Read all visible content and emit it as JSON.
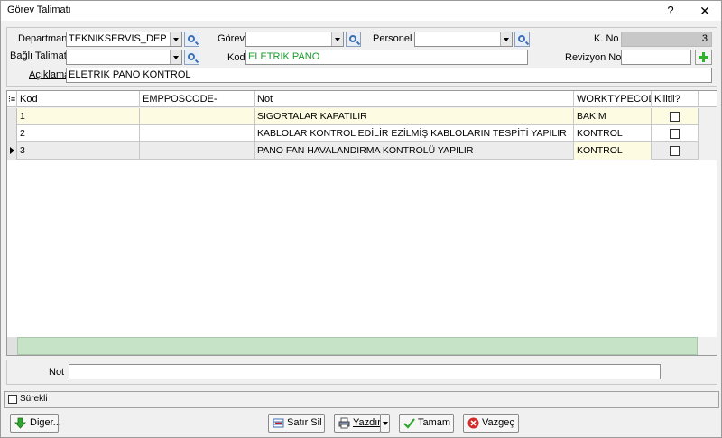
{
  "window": {
    "title": "Görev Talimatı",
    "help": "?",
    "close": "✕"
  },
  "form": {
    "departman_label": "Departman",
    "departman_value": "TEKNIKSERVIS_DEP",
    "gorev_label": "Görev",
    "gorev_value": "",
    "personel_label": "Personel",
    "personel_value": "",
    "kno_label": "K. No",
    "kno_value": "3",
    "bagli_label": "Bağlı Talimat",
    "bagli_value": "",
    "kod_label": "Kod",
    "kod_value": "ELETRIK PANO",
    "revizyon_label": "Revizyon No",
    "revizyon_value": "",
    "aciklama_label": "Açıklama",
    "aciklama_value": "ELETRIK PANO KONTROL"
  },
  "grid": {
    "columns": [
      "Kod",
      "EMPPOSCODE-",
      "Not",
      "WORKTYPECOD",
      "Kilitli?"
    ],
    "rows": [
      {
        "kod": "1",
        "emp": "",
        "not": "SIGORTALAR KAPATILIR",
        "worktype": "BAKIM",
        "kilitli": false
      },
      {
        "kod": "2",
        "emp": "",
        "not": "KABLOLAR KONTROL EDİLİR EZİLMİŞ KABLOLARIN TESPİTİ YAPILIR",
        "worktype": "KONTROL",
        "kilitli": false
      },
      {
        "kod": "3",
        "emp": "",
        "not": "PANO FAN HAVALANDIRMA KONTROLÜ YAPILIR",
        "worktype": "KONTROL",
        "kilitli": false
      }
    ],
    "current_row": 3
  },
  "not_field": {
    "label": "Not",
    "value": ""
  },
  "footer": {
    "surekli_label": "Sürekli",
    "diger_label": "Diger...",
    "satir_sil_label": "Satır Sil",
    "yazdir_label": "Yazdır",
    "tamam_label": "Tamam",
    "vazgec_label": "Vazgeç"
  },
  "colors": {
    "highlight_row": "#fdfbe2",
    "grid_footer": "#c7e3c7",
    "green_text": "#1a9b2a"
  }
}
